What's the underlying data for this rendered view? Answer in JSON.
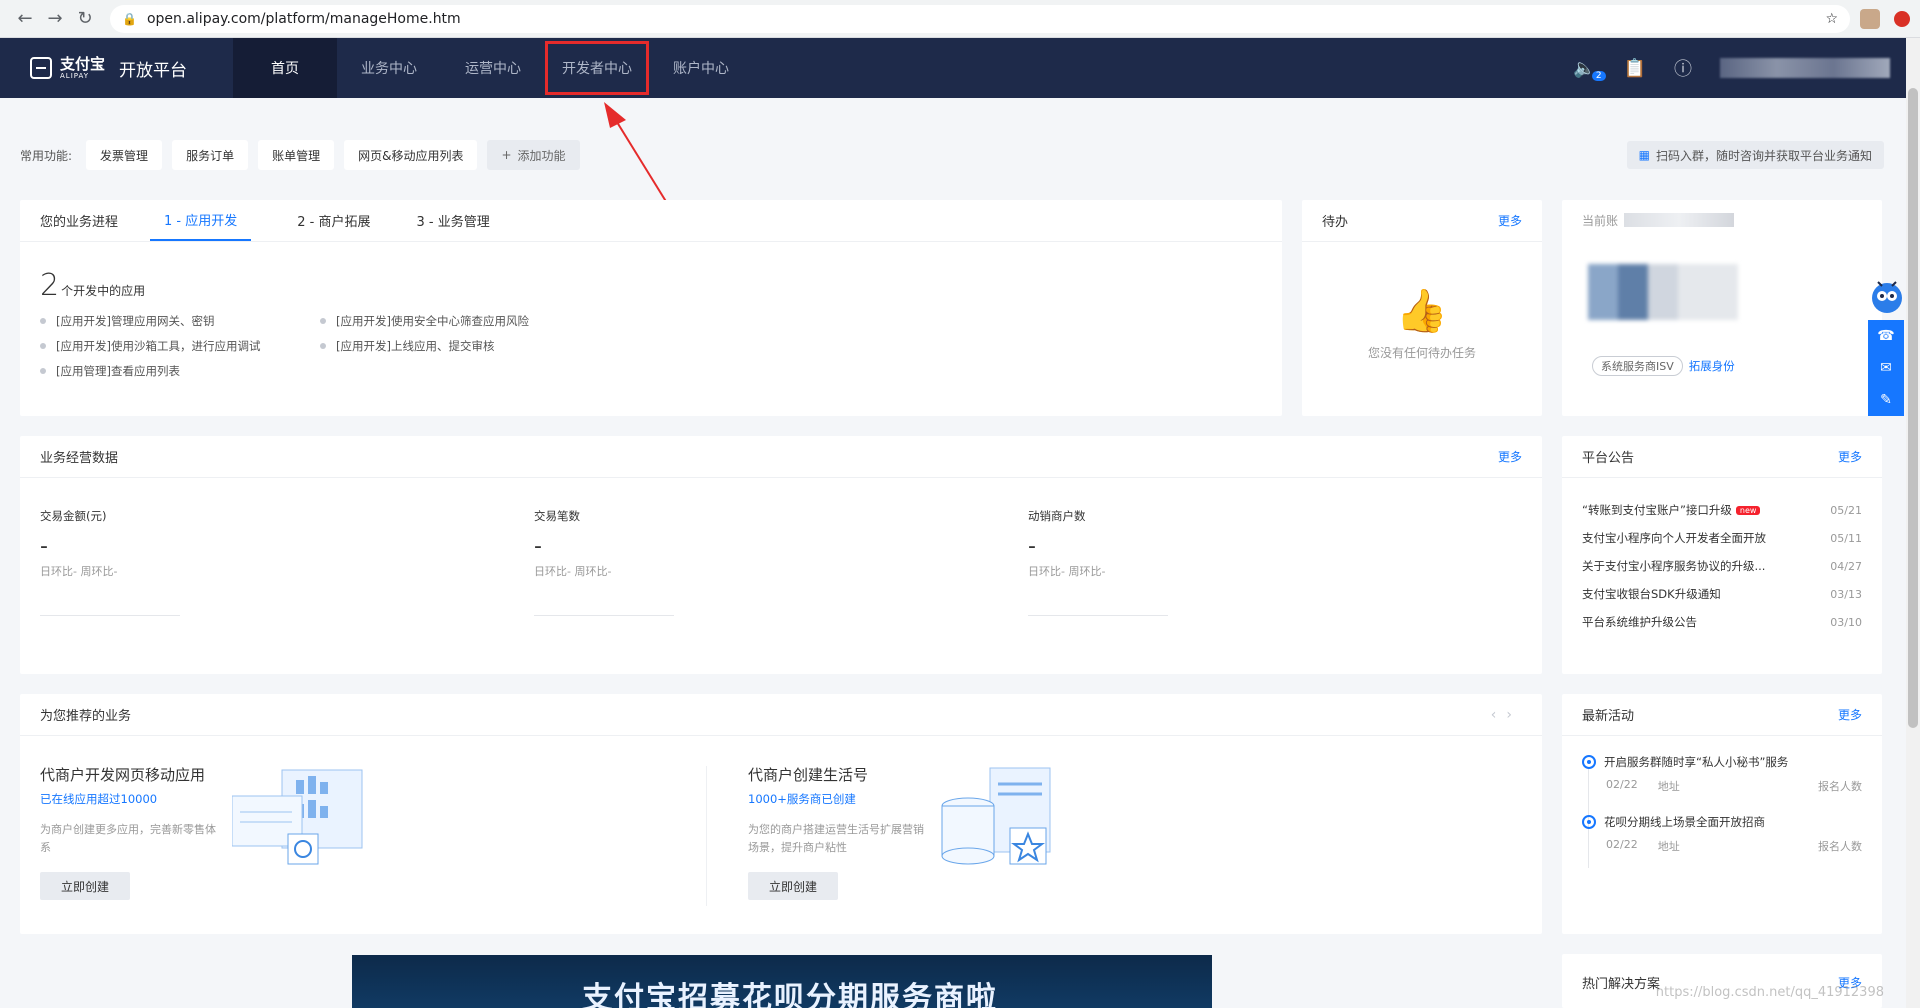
{
  "browser": {
    "url": "open.alipay.com/platform/manageHome.htm"
  },
  "header": {
    "logo_cn": "支付宝",
    "logo_en": "ALIPAY",
    "platform": "开放平台",
    "nav": [
      "首页",
      "业务中心",
      "运营中心",
      "开发者中心",
      "账户中心"
    ],
    "notice_count": "2"
  },
  "quick": {
    "label": "常用功能:",
    "buttons": [
      "发票管理",
      "服务订单",
      "账单管理",
      "网页&移动应用列表"
    ],
    "add": "添加功能",
    "qr_tip": "扫码入群，随时咨询并获取平台业务通知"
  },
  "progress": {
    "title": "您的业务进程",
    "tabs": [
      "1 - 应用开发",
      "2 - 商户拓展",
      "3 - 业务管理"
    ],
    "count": "2",
    "count_unit": "个开发中的应用",
    "tasks": [
      "[应用开发]管理应用网关、密钥",
      "[应用开发]使用安全中心筛查应用风险",
      "[应用开发]使用沙箱工具，进行应用调试",
      "[应用开发]上线应用、提交审核",
      "[应用管理]查看应用列表"
    ]
  },
  "todo": {
    "title": "待办",
    "more": "更多",
    "empty": "您没有任何待办任务"
  },
  "account": {
    "prefix": "当前账",
    "isv_tag": "系统服务商ISV",
    "expand": "拓展身份"
  },
  "business": {
    "title": "业务经营数据",
    "more": "更多",
    "metrics": [
      {
        "label": "交易金额(元)",
        "value": "-",
        "sub": "日环比-   周环比-"
      },
      {
        "label": "交易笔数",
        "value": "-",
        "sub": "日环比-   周环比-"
      },
      {
        "label": "动销商户数",
        "value": "-",
        "sub": "日环比-   周环比-"
      }
    ]
  },
  "notices": {
    "title": "平台公告",
    "more": "更多",
    "new_tag": "new",
    "items": [
      {
        "title": "“转账到支付宝账户”接口升级",
        "date": "05/21"
      },
      {
        "title": "支付宝小程序向个人开发者全面开放",
        "date": "05/11"
      },
      {
        "title": "关于支付宝小程序服务协议的升级...",
        "date": "04/27"
      },
      {
        "title": "支付宝收银台SDK升级通知",
        "date": "03/13"
      },
      {
        "title": "平台系统维护升级公告",
        "date": "03/10"
      }
    ]
  },
  "recommend": {
    "title": "为您推荐的业务",
    "items": [
      {
        "title": "代商户开发网页移动应用",
        "sub": "已在线应用超过10000",
        "desc": "为商户创建更多应用，完善新零售体系",
        "btn": "立即创建"
      },
      {
        "title": "代商户创建生活号",
        "sub": "1000+服务商已创建",
        "desc": "为您的商户搭建运营生活号扩展营销场景，提升商户粘性",
        "btn": "立即创建"
      }
    ]
  },
  "activities": {
    "title": "最新活动",
    "more": "更多",
    "items": [
      {
        "title": "开启服务群随时享“私人小秘书”服务",
        "date": "02/22",
        "place": "地址",
        "join": "报名人数"
      },
      {
        "title": "花呗分期线上场景全面开放招商",
        "date": "02/22",
        "place": "地址",
        "join": "报名人数"
      }
    ]
  },
  "banner": {
    "text": "支付宝招募花呗分期服务商啦"
  },
  "solutions": {
    "title": "热门解决方案",
    "more": "更多"
  },
  "watermark": "https://blog.csdn.net/qq_41912398"
}
